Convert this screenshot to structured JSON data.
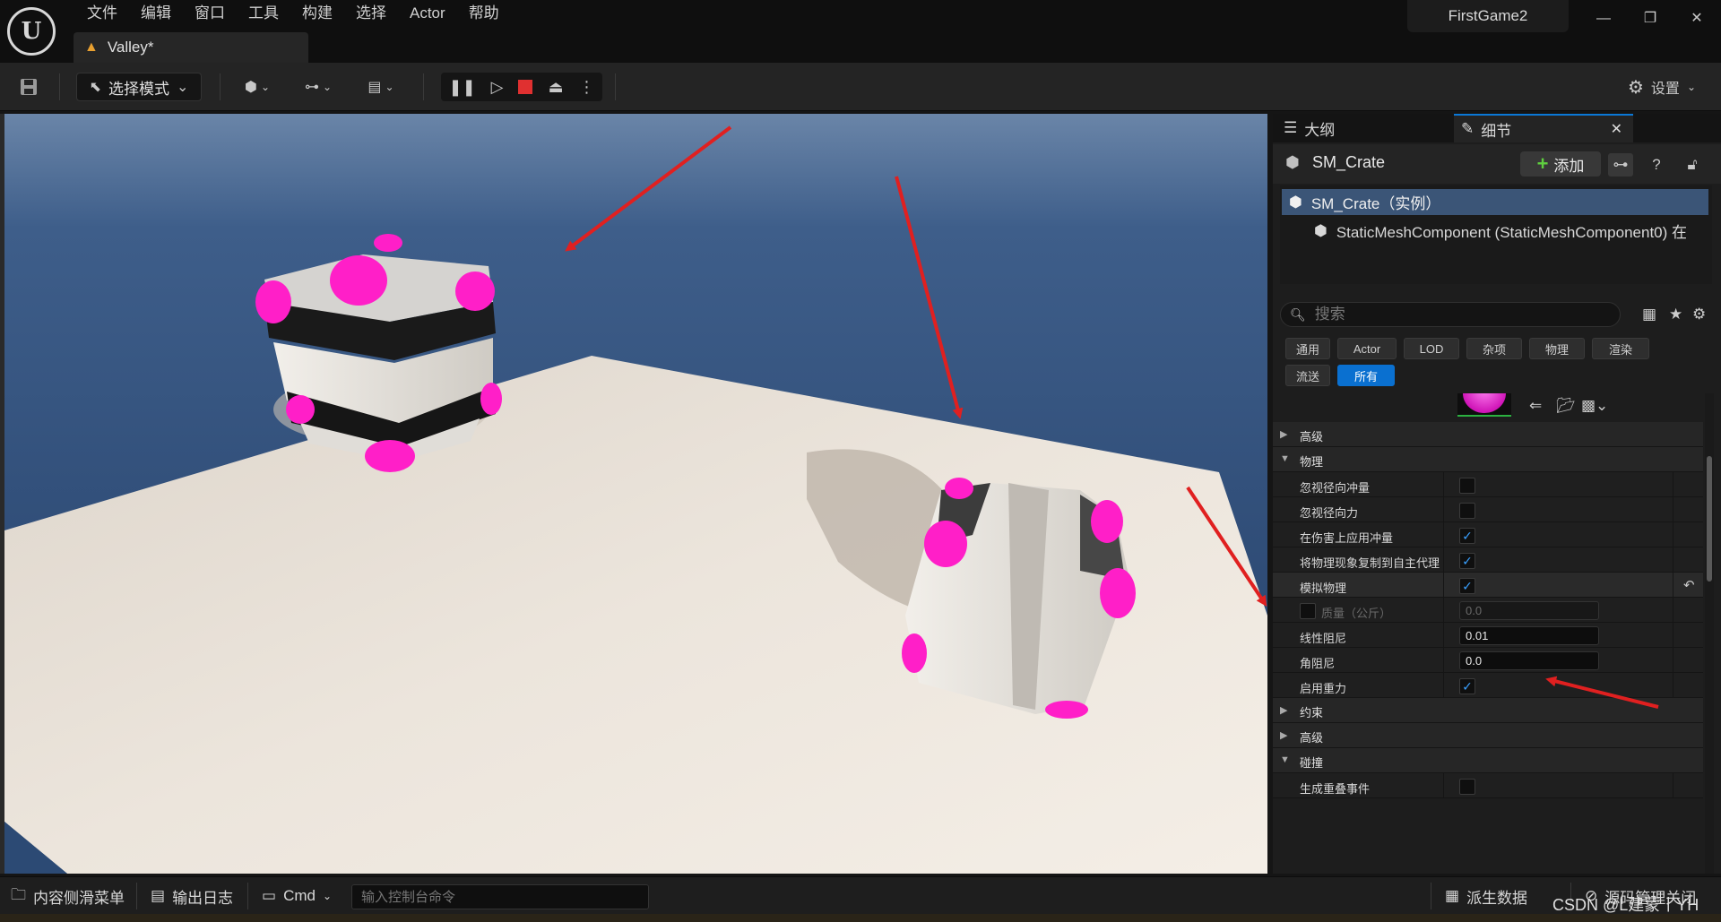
{
  "menu": [
    "文件",
    "编辑",
    "窗口",
    "工具",
    "构建",
    "选择",
    "Actor",
    "帮助"
  ],
  "project_name": "FirstGame2",
  "level_tab": "Valley*",
  "toolbar": {
    "mode_label": "选择模式",
    "settings_label": "设置"
  },
  "panel": {
    "tab_outliner": "大纲",
    "tab_details": "细节",
    "actor_name": "SM_Crate",
    "add_label": "添加",
    "component_root": "SM_Crate（实例）",
    "component_child": "StaticMeshComponent (StaticMeshComponent0)  在",
    "search_placeholder": "搜索",
    "filters": [
      "通用",
      "Actor",
      "LOD",
      "杂项",
      "物理",
      "渲染",
      "流送",
      "所有"
    ],
    "active_filter": "所有",
    "sections": {
      "advanced1": "高级",
      "physics": "物理",
      "constraints": "约束",
      "advanced2": "高级",
      "collision": "碰撞"
    },
    "properties": {
      "ignore_radial_impulse": "忽视径向冲量",
      "ignore_radial_force": "忽视径向力",
      "apply_impulse_on_damage": "在伤害上应用冲量",
      "replicate_physics": "将物理现象复制到自主代理",
      "simulate_physics": "模拟物理",
      "mass_kg": "质量（公斤）",
      "mass_value": "0.0",
      "linear_damping": "线性阻尼",
      "linear_damping_value": "0.01",
      "angular_damping": "角阻尼",
      "angular_damping_value": "0.0",
      "enable_gravity": "启用重力",
      "generate_overlap_events": "生成重叠事件"
    }
  },
  "statusbar": {
    "content_drawer": "内容侧滑菜单",
    "output_log": "输出日志",
    "cmd_label": "Cmd",
    "cmd_placeholder": "输入控制台命令",
    "derived_data": "派生数据",
    "source_control": "源码管理关闭"
  },
  "watermark": "CSDN @L建蒙丨YH",
  "colors": {
    "accent": "#0a70d0",
    "crate_pink": "#ff1fc8",
    "arrow_red": "#e02020",
    "sky": "#2c4a74",
    "floor": "#ece5dc"
  }
}
